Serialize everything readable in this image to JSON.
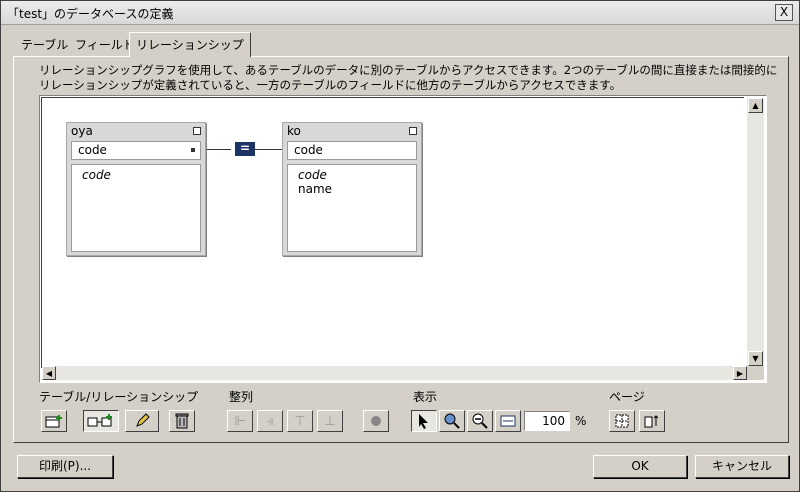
{
  "window": {
    "title": "「test」のデータベースの定義",
    "close_label": "X"
  },
  "tabs": [
    {
      "label": "テーブル"
    },
    {
      "label": "フィールド"
    },
    {
      "label": "リレーションシップ",
      "active": true
    }
  ],
  "description": "リレーションシップグラフを使用して、あるテーブルのデータに別のテーブルからアクセスできます。2つのテーブルの間に直接または間接的にリレーションシップが定義されていると、一方のテーブルのフィールドに他方のテーブルからアクセスできます。",
  "graph": {
    "tables": [
      {
        "name": "oya",
        "key_field": "code",
        "fields": [
          {
            "name": "code",
            "italic": true
          }
        ]
      },
      {
        "name": "ko",
        "key_field": "code",
        "fields": [
          {
            "name": "code",
            "italic": true
          },
          {
            "name": "name",
            "italic": false
          }
        ]
      }
    ],
    "relationship": {
      "operator": "="
    }
  },
  "toolbar": {
    "groups": {
      "tables_relationships": "テーブル/リレーションシップ",
      "arrange": "整列",
      "view": "表示",
      "page": "ページ"
    },
    "zoom_value": "100",
    "zoom_unit": "%"
  },
  "buttons": {
    "print": "印刷(P)...",
    "ok": "OK",
    "cancel": "キャンセル"
  }
}
